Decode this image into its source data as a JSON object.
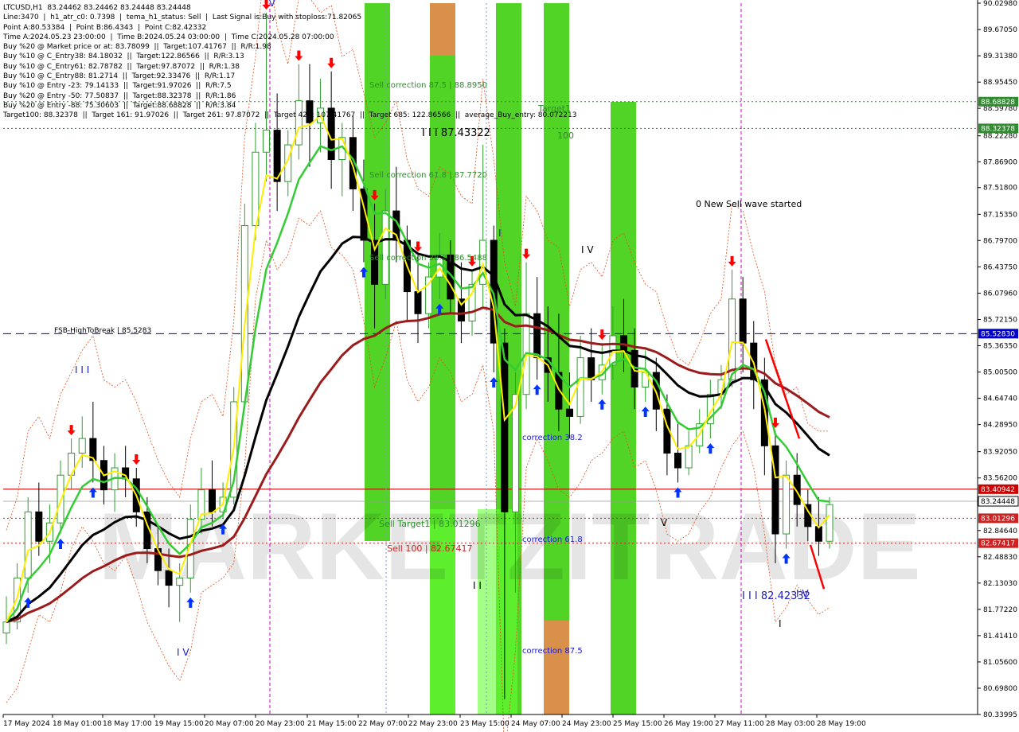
{
  "info": {
    "lines": [
      "LTCUSD,H1  83.24462 83.24462 83.24448 83.24448",
      "Line:3470  |  h1_atr_c0: 0.7398  |  tema_h1_status: Sell  |  Last Signal is:Buy with stoploss:71.82065",
      "Point A:80.53384  |  Point B:86.4343  |  Point C:82.42332",
      "Time A:2024.05.23 23:00:00  |  Time B:2024.05.24 03:00:00  |  Time C:2024.05.28 07:00:00",
      "Buy %20 @ Market price or at: 83.78099  ||  Target:107.41767  ||  R/R:1.98",
      "Buy %10 @ C_Entry38: 84.18032  ||  Target:122.86566  ||  R/R:3.13",
      "Buy %10 @ C_Entry61: 82.78782  ||  Target:97.87072  ||  R/R:1.38",
      "Buy %10 @ C_Entry88: 81.2714  ||  Target:92.33476  ||  R/R:1.17",
      "Buy %10 @ Entry -23: 79.14133  ||  Target:91.97026  ||  R/R:7.5",
      "Buy %20 @ Entry -50: 77.50837  ||  Target:88.32378  ||  R/R:1.86",
      "Buy %20 @ Entry -88: 75.30603  ||  Target:88.68828  ||  R/R:3.84",
      "Target100: 88.32378  ||  Target 161: 91.97026  ||  Target 261: 97.87072  ||  Target 423: 107.41767  ||  Target 685: 122.86566  ||  average_Buy_entry: 80.072213"
    ]
  },
  "watermark": "MARKETZITRADE",
  "colors": {
    "bull": "#2ca02c",
    "bear": "#000000",
    "green_zone": "#33cc00",
    "orange_zone": "#d9904a",
    "ma_black": "#000000",
    "ma_brown": "#9b1c1c",
    "ma_green": "#33cc33",
    "ma_yellow": "#ffee00",
    "buy_arrow": "#0033ff",
    "sell_arrow": "#ff0000",
    "label_blue": "#1a1acc"
  },
  "chart_data": {
    "type": "candlestick",
    "symbol": "LTCUSD",
    "timeframe": "H1",
    "ylim": [
      80.33995,
      90.0298
    ],
    "y_ticks": [
      90.0298,
      89.6705,
      89.3138,
      88.9545,
      88.5978,
      88.2228,
      87.869,
      87.518,
      87.1535,
      86.797,
      86.4375,
      86.0796,
      85.7215,
      85.3636,
      85.005,
      84.6474,
      84.2895,
      83.9205,
      83.562,
      83.2053,
      82.8464,
      82.4883,
      82.1303,
      81.7722,
      81.4141,
      81.056,
      80.698,
      80.34
    ],
    "y_tick_labels": [
      "90.02980",
      "89.67050",
      "89.31380",
      "88.95450",
      "88.59780",
      "88.22280",
      "87.86900",
      "87.51800",
      "87.15350",
      "86.79700",
      "86.43750",
      "86.07960",
      "85.72150",
      "85.36350",
      "85.00500",
      "84.64740",
      "84.28950",
      "83.92050",
      "83.56200",
      "83.20530",
      "82.84640",
      "82.48830",
      "82.13030",
      "81.77220",
      "81.41410",
      "81.05600",
      "80.69800",
      "80.33995"
    ],
    "x_tick_labels": [
      "17 May 2024",
      "18 May 01:00",
      "18 May 17:00",
      "19 May 15:00",
      "20 May 07:00",
      "20 May 23:00",
      "21 May 15:00",
      "22 May 07:00",
      "22 May 23:00",
      "23 May 15:00",
      "24 May 07:00",
      "24 May 23:00",
      "25 May 15:00",
      "26 May 19:00",
      "27 May 11:00",
      "28 May 03:00",
      "28 May 19:00"
    ],
    "candles_sampled": [
      {
        "o": 81.45,
        "h": 81.95,
        "c": 81.6,
        "l": 81.3
      },
      {
        "o": 81.6,
        "h": 82.4,
        "c": 82.2,
        "l": 81.5
      },
      {
        "o": 82.2,
        "h": 83.3,
        "c": 83.1,
        "l": 82.0
      },
      {
        "o": 83.1,
        "h": 83.5,
        "c": 82.7,
        "l": 82.5
      },
      {
        "o": 82.7,
        "h": 83.2,
        "c": 82.95,
        "l": 82.4
      },
      {
        "o": 82.95,
        "h": 83.8,
        "c": 83.6,
        "l": 82.8
      },
      {
        "o": 83.6,
        "h": 84.1,
        "c": 83.9,
        "l": 83.4
      },
      {
        "o": 83.9,
        "h": 84.4,
        "c": 84.1,
        "l": 83.7
      },
      {
        "o": 84.1,
        "h": 84.6,
        "c": 83.8,
        "l": 83.5
      },
      {
        "o": 83.8,
        "h": 84.0,
        "c": 83.4,
        "l": 83.2
      },
      {
        "o": 83.4,
        "h": 83.9,
        "c": 83.7,
        "l": 83.1
      },
      {
        "o": 83.7,
        "h": 84.0,
        "c": 83.55,
        "l": 83.3
      },
      {
        "o": 83.55,
        "h": 83.7,
        "c": 83.1,
        "l": 82.9
      },
      {
        "o": 83.1,
        "h": 83.3,
        "c": 82.6,
        "l": 82.4
      },
      {
        "o": 82.6,
        "h": 82.9,
        "c": 82.3,
        "l": 82.1
      },
      {
        "o": 82.3,
        "h": 82.6,
        "c": 82.1,
        "l": 81.8
      },
      {
        "o": 82.1,
        "h": 82.4,
        "c": 82.2,
        "l": 81.6
      },
      {
        "o": 82.2,
        "h": 83.2,
        "c": 83.0,
        "l": 82.0
      },
      {
        "o": 83.0,
        "h": 83.7,
        "c": 83.4,
        "l": 82.8
      },
      {
        "o": 83.4,
        "h": 83.8,
        "c": 83.1,
        "l": 82.9
      },
      {
        "o": 83.1,
        "h": 83.5,
        "c": 83.3,
        "l": 83.0
      },
      {
        "o": 83.3,
        "h": 84.8,
        "c": 84.6,
        "l": 83.2
      },
      {
        "o": 84.6,
        "h": 87.3,
        "c": 87.0,
        "l": 84.5
      },
      {
        "o": 87.0,
        "h": 88.4,
        "c": 88.0,
        "l": 86.8
      },
      {
        "o": 88.0,
        "h": 89.9,
        "c": 88.3,
        "l": 87.6
      },
      {
        "o": 88.3,
        "h": 88.8,
        "c": 87.6,
        "l": 87.2
      },
      {
        "o": 87.6,
        "h": 88.3,
        "c": 88.1,
        "l": 87.4
      },
      {
        "o": 88.1,
        "h": 89.2,
        "c": 88.7,
        "l": 87.9
      },
      {
        "o": 88.7,
        "h": 89.2,
        "c": 88.4,
        "l": 87.8
      },
      {
        "o": 88.4,
        "h": 89.0,
        "c": 88.6,
        "l": 88.0
      },
      {
        "o": 88.6,
        "h": 89.1,
        "c": 87.9,
        "l": 87.5
      },
      {
        "o": 87.9,
        "h": 88.4,
        "c": 88.2,
        "l": 87.4
      },
      {
        "o": 88.2,
        "h": 88.5,
        "c": 87.5,
        "l": 87.2
      },
      {
        "o": 87.5,
        "h": 87.9,
        "c": 86.8,
        "l": 86.5
      },
      {
        "o": 86.8,
        "h": 87.3,
        "c": 86.2,
        "l": 85.6
      },
      {
        "o": 86.2,
        "h": 87.5,
        "c": 87.2,
        "l": 86.0
      },
      {
        "o": 87.2,
        "h": 87.8,
        "c": 86.8,
        "l": 86.5
      },
      {
        "o": 86.8,
        "h": 87.0,
        "c": 86.1,
        "l": 85.7
      },
      {
        "o": 86.1,
        "h": 86.6,
        "c": 85.8,
        "l": 85.4
      },
      {
        "o": 85.8,
        "h": 86.5,
        "c": 86.3,
        "l": 85.6
      },
      {
        "o": 86.3,
        "h": 86.9,
        "c": 86.6,
        "l": 86.0
      },
      {
        "o": 86.6,
        "h": 86.8,
        "c": 86.0,
        "l": 85.8
      },
      {
        "o": 86.0,
        "h": 86.5,
        "c": 85.7,
        "l": 85.4
      },
      {
        "o": 85.7,
        "h": 86.4,
        "c": 86.2,
        "l": 85.5
      },
      {
        "o": 86.2,
        "h": 88.1,
        "c": 86.8,
        "l": 85.9
      },
      {
        "o": 86.8,
        "h": 87.0,
        "c": 85.4,
        "l": 85.0
      },
      {
        "o": 85.4,
        "h": 85.6,
        "c": 83.1,
        "l": 80.55
      },
      {
        "o": 83.1,
        "h": 85.0,
        "c": 84.7,
        "l": 82.0
      },
      {
        "o": 84.7,
        "h": 86.5,
        "c": 85.8,
        "l": 84.5
      },
      {
        "o": 85.8,
        "h": 86.3,
        "c": 85.2,
        "l": 84.9
      },
      {
        "o": 85.2,
        "h": 85.9,
        "c": 85.0,
        "l": 84.6
      },
      {
        "o": 85.0,
        "h": 85.8,
        "c": 84.5,
        "l": 84.2
      },
      {
        "o": 84.5,
        "h": 85.0,
        "c": 84.4,
        "l": 84.1
      },
      {
        "o": 84.4,
        "h": 85.5,
        "c": 85.2,
        "l": 84.3
      },
      {
        "o": 85.2,
        "h": 85.6,
        "c": 84.9,
        "l": 84.6
      },
      {
        "o": 84.9,
        "h": 85.4,
        "c": 85.1,
        "l": 84.7
      },
      {
        "o": 85.1,
        "h": 85.9,
        "c": 85.5,
        "l": 84.9
      },
      {
        "o": 85.5,
        "h": 86.0,
        "c": 85.3,
        "l": 85.0
      },
      {
        "o": 85.3,
        "h": 85.6,
        "c": 84.8,
        "l": 84.5
      },
      {
        "o": 84.8,
        "h": 85.3,
        "c": 85.0,
        "l": 84.6
      },
      {
        "o": 85.0,
        "h": 85.2,
        "c": 84.5,
        "l": 84.2
      },
      {
        "o": 84.5,
        "h": 84.7,
        "c": 83.9,
        "l": 83.6
      },
      {
        "o": 83.9,
        "h": 84.3,
        "c": 83.7,
        "l": 83.5
      },
      {
        "o": 83.7,
        "h": 84.2,
        "c": 84.0,
        "l": 83.6
      },
      {
        "o": 84.0,
        "h": 84.5,
        "c": 84.3,
        "l": 83.9
      },
      {
        "o": 84.3,
        "h": 84.9,
        "c": 84.7,
        "l": 84.1
      },
      {
        "o": 84.7,
        "h": 85.1,
        "c": 84.9,
        "l": 84.5
      },
      {
        "o": 84.9,
        "h": 86.4,
        "c": 86.0,
        "l": 84.8
      },
      {
        "o": 86.0,
        "h": 86.3,
        "c": 85.4,
        "l": 85.0
      },
      {
        "o": 85.4,
        "h": 85.7,
        "c": 84.9,
        "l": 84.5
      },
      {
        "o": 84.9,
        "h": 85.2,
        "c": 84.0,
        "l": 83.6
      },
      {
        "o": 84.0,
        "h": 84.2,
        "c": 82.8,
        "l": 82.4
      },
      {
        "o": 82.8,
        "h": 83.8,
        "c": 83.6,
        "l": 82.6
      },
      {
        "o": 83.6,
        "h": 83.9,
        "c": 83.2,
        "l": 82.9
      },
      {
        "o": 83.2,
        "h": 83.4,
        "c": 82.9,
        "l": 82.7
      },
      {
        "o": 82.9,
        "h": 83.3,
        "c": 82.7,
        "l": 82.5
      },
      {
        "o": 82.7,
        "h": 83.3,
        "c": 83.2,
        "l": 82.6
      }
    ],
    "indicators": [
      "Moving average (black)",
      "Moving average (brown)",
      "Moving average (green)",
      "Moving average (yellow)"
    ],
    "horizontal_levels": [
      {
        "value": 88.68828,
        "label": "88.68828",
        "color": "#2e8b2e",
        "style": "dotted"
      },
      {
        "value": 88.32378,
        "label": "88.32378",
        "color": "#2e8b2e",
        "style": "dotted"
      },
      {
        "value": 85.5283,
        "label": "85.52830",
        "color": "#0000cc",
        "style": "dashed"
      },
      {
        "value": 83.40942,
        "label": "83.40942",
        "color": "#cc0000",
        "style": "solid"
      },
      {
        "value": 83.24448,
        "label": "83.24448",
        "color": "#333333",
        "style": "current"
      },
      {
        "value": 83.01296,
        "label": "83.01296",
        "color": "#cc2222",
        "style": "dotted"
      },
      {
        "value": 82.67417,
        "label": "82.67417",
        "color": "#cc2222",
        "style": "dotted"
      }
    ],
    "annotations": [
      {
        "text": "Sell correction 87.5 | 88.8950",
        "color": "#2e8b2e"
      },
      {
        "text": "I I I 87.43322",
        "color": "#000000"
      },
      {
        "text": "Sell correction 61.8 | 87.7720",
        "color": "#2e8b2e"
      },
      {
        "text": "Sell correction 38.2 | 86.5488",
        "color": "#2e8b2e"
      },
      {
        "text": "Target1",
        "color": "#2e8b2e"
      },
      {
        "text": "100",
        "color": "#2e8b2e"
      },
      {
        "text": "0 New Sell wave started",
        "color": "#000000"
      },
      {
        "text": "FSB-HighToBreak | 85.5283",
        "color": "#000000"
      },
      {
        "text": "I V",
        "color": "#1a1acc"
      },
      {
        "text": "I I I",
        "color": "#1a1acc"
      },
      {
        "text": "I V",
        "color": "#000000"
      },
      {
        "text": "I V",
        "color": "#1a1acc"
      },
      {
        "text": "correction 38.2",
        "color": "#1a1acc"
      },
      {
        "text": "correction 61.8",
        "color": "#1a1acc"
      },
      {
        "text": "correction 87.5",
        "color": "#1a1acc"
      },
      {
        "text": "Sell Target1 | 83.01296",
        "color": "#2e8b2e"
      },
      {
        "text": "Sell 100 | 82.67417",
        "color": "#cc2222"
      },
      {
        "text": "V",
        "color": "#000000"
      },
      {
        "text": "I I I 82.42332",
        "color": "#1a1acc"
      },
      {
        "text": "I",
        "color": "#000000"
      },
      {
        "text": "I I",
        "color": "#000000"
      },
      {
        "text": "I",
        "color": "#1a1acc"
      },
      {
        "text": "V",
        "color": "#1a1acc"
      }
    ]
  }
}
